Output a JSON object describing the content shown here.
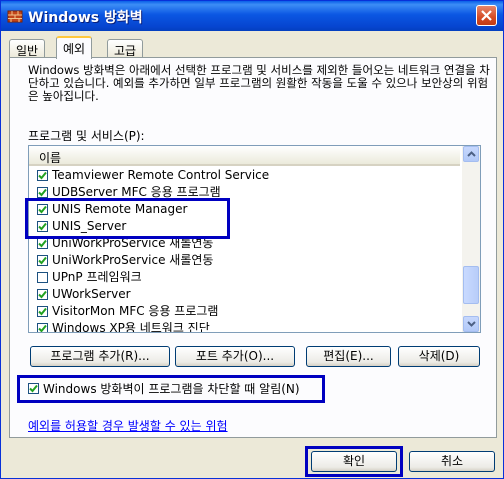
{
  "window": {
    "title": "Windows 방화벽",
    "close_label": "✕"
  },
  "tabs": [
    {
      "label": "일반"
    },
    {
      "label": "예외"
    },
    {
      "label": "고급"
    }
  ],
  "description": "Windows 방화벽은 아래에서 선택한 프로그램 및 서비스를 제외한 들어오는 네트워크 연결을 차단하고 있습니다. 예외를 추가하면 일부 프로그램의 원활한 작동을 도울 수 있으나 보안상의 위험은 높아집니다.",
  "list": {
    "label": "프로그램 및 서비스(P):",
    "column_header": "이름",
    "items": [
      {
        "name": "Teamviewer Remote Control Service",
        "checked": true
      },
      {
        "name": "UDBServer MFC 응용 프로그램",
        "checked": true
      },
      {
        "name": "UNIS Remote Manager",
        "checked": true
      },
      {
        "name": "UNIS_Server",
        "checked": true
      },
      {
        "name": "UniWorkProService 새롤연동",
        "checked": true
      },
      {
        "name": "UniWorkProService 새롤연동",
        "checked": true
      },
      {
        "name": "UPnP 프레임워크",
        "checked": false
      },
      {
        "name": "UWorkServer",
        "checked": true
      },
      {
        "name": "VisitorMon MFC 응용 프로그램",
        "checked": true
      },
      {
        "name": "Windows XP용 네트워크 진단",
        "checked": true
      }
    ]
  },
  "buttons": {
    "add_program": "프로그램 추가(R)...",
    "add_port": "포트 추가(O)...",
    "edit": "편집(E)...",
    "delete": "삭제(D)",
    "ok": "확인",
    "cancel": "취소"
  },
  "notify": {
    "label": "Windows 방화벽이 프로그램을 차단할 때 알림(N)",
    "checked": true
  },
  "risk_link": "예외를 허용할 경우 발생할 수 있는 위험",
  "colors": {
    "highlight_border": "#0000c0",
    "titlebar": "#0b57e3",
    "link": "#0000ff"
  }
}
